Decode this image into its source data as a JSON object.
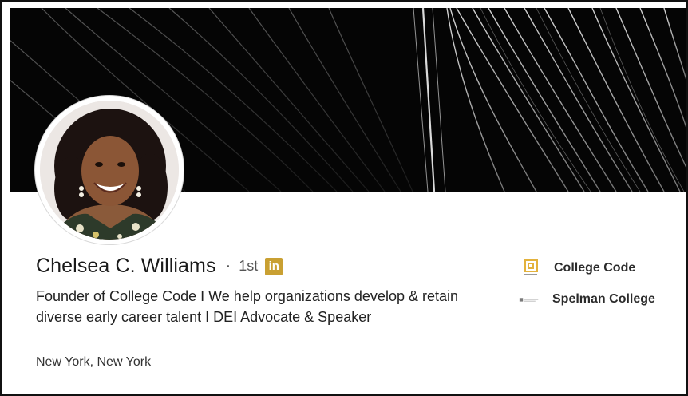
{
  "profile": {
    "name": "Chelsea C. Williams",
    "separator": "·",
    "degree": "1st",
    "linkedin_badge": "in",
    "headline": "Founder of College Code I We help organizations develop & retain diverse early career talent I DEI Advocate & Speaker",
    "location": "New York, New York"
  },
  "affiliations": [
    {
      "label": "College Code",
      "icon": "college-code-logo-icon"
    },
    {
      "label": "Spelman College",
      "icon": "spelman-college-logo-icon"
    }
  ],
  "colors": {
    "banner": "#050505",
    "linkedin_badge": "#c9a032",
    "college_code_logo": "#e3b23c"
  }
}
